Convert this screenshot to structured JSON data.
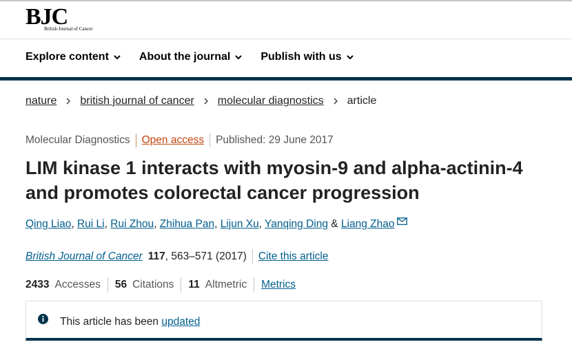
{
  "header": {
    "logo_text": "BJC",
    "logo_subtitle": "British Journal of Cancer"
  },
  "nav": {
    "items": [
      {
        "label": "Explore content"
      },
      {
        "label": "About the journal"
      },
      {
        "label": "Publish with us"
      }
    ]
  },
  "breadcrumb": [
    {
      "label": "nature"
    },
    {
      "label": "british journal of cancer"
    },
    {
      "label": "molecular diagnostics"
    },
    {
      "label": "article"
    }
  ],
  "article": {
    "type": "Molecular Diagnostics",
    "access": "Open access",
    "published": "Published: 29 June 2017",
    "title": "LIM kinase 1 interacts with myosin-9 and alpha-actinin-4 and promotes colorectal cancer progression",
    "authors": [
      "Qing Liao",
      "Rui Li",
      "Rui Zhou",
      "Zhihua Pan",
      "Lijun Xu",
      "Yanqing Ding",
      "Liang Zhao"
    ],
    "author_ampersand": "&",
    "journal": "British Journal of Cancer",
    "volume": "117",
    "pages_year": ", 563–571 (2017)",
    "cite_label": "Cite this article"
  },
  "metrics": {
    "accesses_value": "2433",
    "accesses_label": "Accesses",
    "citations_value": "56",
    "citations_label": "Citations",
    "altmetric_value": "11",
    "altmetric_label": "Altmetric",
    "metrics_link": "Metrics"
  },
  "notice": {
    "text": "This article has been",
    "link": "updated"
  },
  "colors": {
    "link": "#025e8d",
    "open_access": "#c1450e",
    "brand_band": "#01324b"
  }
}
